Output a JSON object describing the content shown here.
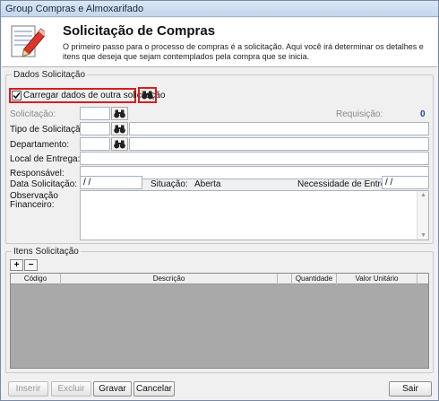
{
  "window": {
    "title": "Group Compras e Almoxarifado"
  },
  "header": {
    "icon": "document-pencil-icon",
    "title": "Solicitação de Compras",
    "description": "O primeiro passo para o processo de compras é a solicitação. Aqui você irá determinar os detalhes e itens que deseja que sejam contemplados pela compra que se inicia."
  },
  "dados": {
    "legend": "Dados Solicitação",
    "carregar_label": "Carregar dados de outra solicitação",
    "carregar_checked": true,
    "solicitacao_label": "Solicitação:",
    "solicitacao_value": "",
    "requisicao_label": "Requisição:",
    "requisicao_value": "0",
    "tipo_label": "Tipo de Solicitação:",
    "tipo_code": "",
    "tipo_desc": "",
    "departamento_label": "Departamento:",
    "departamento_code": "",
    "departamento_desc": "",
    "local_label": "Local de Entrega:",
    "local_value": "",
    "responsavel_label": "Responsável:",
    "responsavel_value": "",
    "data_label": "Data Solicitação:",
    "data_value": "/ /",
    "situacao_label": "Situação:",
    "situacao_value": "Aberta",
    "necessidade_label": "Necessidade de Entrega:",
    "necessidade_value": "/ /",
    "observacao_label_line1": "Observação",
    "observacao_label_line2": "Financeiro:",
    "observacao_value": ""
  },
  "itens": {
    "legend": "Itens Solicitação",
    "add_label": "+",
    "remove_label": "−",
    "columns": [
      "Código",
      "Descrição",
      "Quantidade",
      "Valor Unitário"
    ],
    "rows": []
  },
  "footer": {
    "inserir_label": "Inserir",
    "excluir_label": "Excluir",
    "gravar_label": "Gravar",
    "cancelar_label": "Cancelar",
    "sair_label": "Sair"
  },
  "colors": {
    "highlight": "#d42020",
    "requisicao_value": "#1a3fbf",
    "grid_background": "#a9a9a9"
  }
}
